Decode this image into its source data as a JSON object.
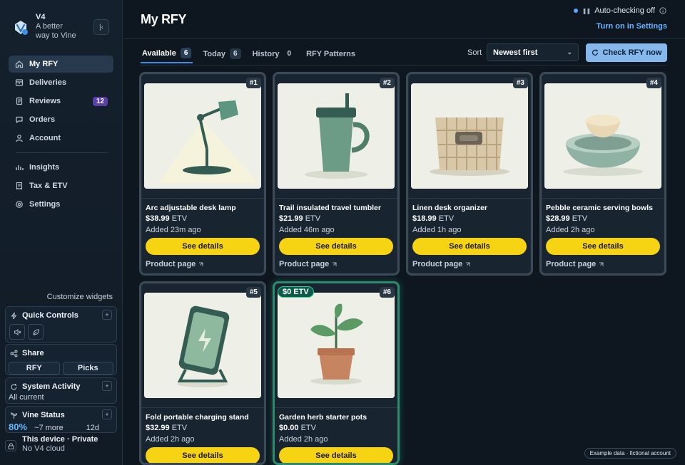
{
  "brand": {
    "name": "V4",
    "tagline_1": "A better",
    "tagline_2": "way to Vine"
  },
  "nav": {
    "items": [
      {
        "label": "My RFY",
        "icon": "home-icon",
        "active": true
      },
      {
        "label": "Deliveries",
        "icon": "box-icon"
      },
      {
        "label": "Reviews",
        "icon": "document-icon",
        "badge": "12"
      },
      {
        "label": "Orders",
        "icon": "speech-bubble-icon"
      },
      {
        "label": "Account",
        "icon": "user-icon"
      },
      {
        "label": "Insights",
        "icon": "bar-chart-icon"
      },
      {
        "label": "Tax & ETV",
        "icon": "receipt-icon"
      },
      {
        "label": "Settings",
        "icon": "gear-icon"
      }
    ]
  },
  "widgets": {
    "customize_label": "Customize widgets",
    "quick_controls": {
      "title": "Quick Controls"
    },
    "share": {
      "title": "Share",
      "tab_1": "RFY",
      "tab_2": "Picks"
    },
    "system_activity": {
      "title": "System Activity",
      "status": "All current"
    },
    "vine_status": {
      "title": "Vine Status",
      "percent": "80%",
      "more": "~7 more",
      "days": "12d"
    },
    "device": {
      "title": "This device · Private",
      "subtitle": "No V4 cloud"
    }
  },
  "header": {
    "title": "My RFY",
    "auto_check": "Auto-checking off",
    "turn_on_link": "Turn on in Settings"
  },
  "tabs": [
    {
      "label": "Available",
      "count": "6",
      "active": true
    },
    {
      "label": "Today",
      "count": "6"
    },
    {
      "label": "History",
      "count": "0"
    },
    {
      "label": "RFY Patterns",
      "count": ""
    }
  ],
  "sort": {
    "label": "Sort",
    "value": "Newest first"
  },
  "check_button": "Check RFY now",
  "card_common": {
    "details_label": "See details",
    "product_link": "Product page",
    "etv_suffix": "ETV"
  },
  "cards": [
    {
      "num": "#1",
      "name": "Arc adjustable desk lamp",
      "price": "$38.99",
      "added": "Added 23m ago",
      "image": "lamp"
    },
    {
      "num": "#2",
      "name": "Trail insulated travel tumbler",
      "price": "$21.99",
      "added": "Added 46m ago",
      "image": "tumbler"
    },
    {
      "num": "#3",
      "name": "Linen desk organizer",
      "price": "$18.99",
      "added": "Added 1h ago",
      "image": "organizer"
    },
    {
      "num": "#4",
      "name": "Pebble ceramic serving bowls",
      "price": "$28.99",
      "added": "Added 2h ago",
      "image": "bowls"
    },
    {
      "num": "#5",
      "name": "Fold portable charging stand",
      "price": "$32.99",
      "added": "Added 2h ago",
      "image": "charger"
    },
    {
      "num": "#6",
      "name": "Garden herb starter pots",
      "price": "$0.00",
      "added": "Added 2h ago",
      "image": "plant",
      "badge": "$0 ETV"
    }
  ],
  "footer_note": "Example data · fictional account"
}
